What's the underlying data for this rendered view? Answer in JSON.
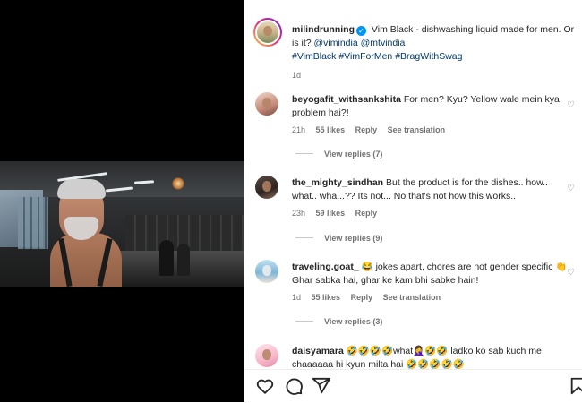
{
  "post": {
    "author": "milindrunning",
    "caption_text": "Vim Black - dishwashing liquid made for men. Or is it?",
    "mentions": [
      "@vimindia",
      "@mtvindia"
    ],
    "hashtags": [
      "#VimBlack",
      "#VimForMen",
      "#BragWithSwag"
    ],
    "age": "1d"
  },
  "comments": [
    {
      "user": "beyogafit_withsankshita",
      "text": "For men? Kyu? Yellow wale mein kya problem hai?!",
      "time": "21h",
      "likes": "55 likes",
      "reply": "Reply",
      "translate": "See translation",
      "view_replies": "View replies (7)"
    },
    {
      "user": "the_mighty_sindhan",
      "text": "But the product is for the dishes.. how.. what.. wha...?? Its not... No that's not how this works..",
      "time": "23h",
      "likes": "59 likes",
      "reply": "Reply",
      "view_replies": "View replies (9)"
    },
    {
      "user": "traveling.goat_",
      "text": "😂 jokes apart, chores are not gender specific 👏 Ghar sabka hai, ghar ke kam bhi sabke hain!",
      "time": "1d",
      "likes": "55 likes",
      "reply": "Reply",
      "translate": "See translation",
      "view_replies": "View replies (3)"
    },
    {
      "user": "daisyamara",
      "text": "🤣🤣🤣🤣what🤦‍♀️🤣🤣 ladko ko sab kuch me chaaaaaa hi kyun milta hai 🤣🤣🤣🤣🤣"
    }
  ],
  "actions": {
    "like_icon": "heart-icon",
    "comment_icon": "comment-icon",
    "share_icon": "share-icon",
    "save_icon": "bookmark-icon"
  },
  "colors": {
    "link": "#00376b",
    "verified": "#0095f6",
    "muted": "#737373"
  }
}
